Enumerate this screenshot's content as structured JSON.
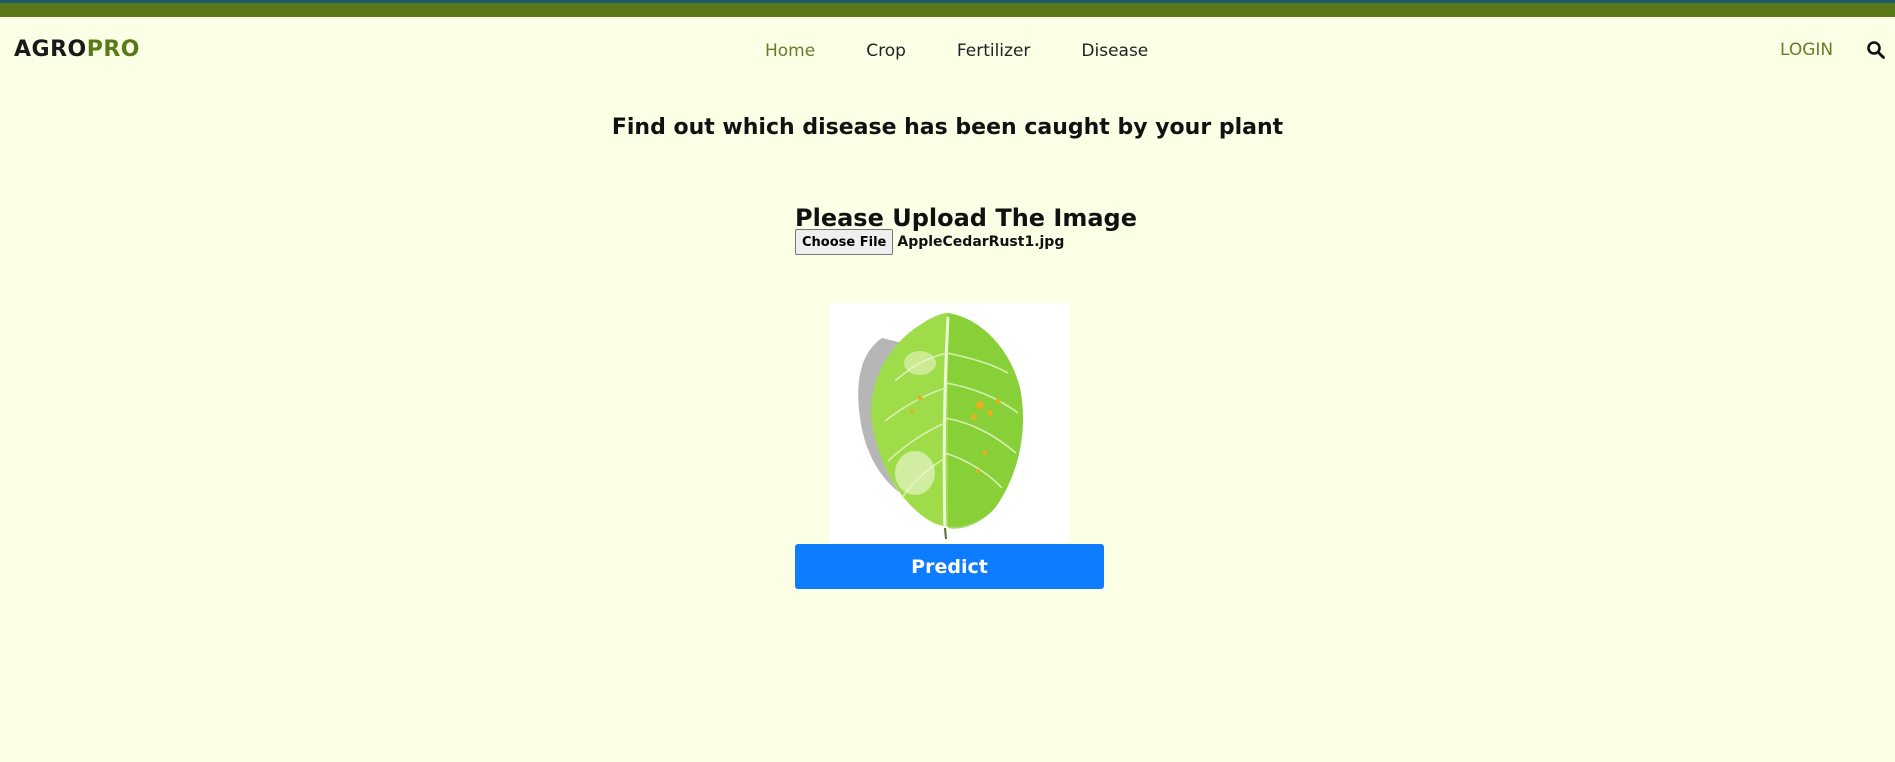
{
  "header": {
    "logo_main": "AGRO",
    "logo_accent": "PRO",
    "nav": [
      {
        "label": "Home"
      },
      {
        "label": "Crop"
      },
      {
        "label": "Fertilizer"
      },
      {
        "label": "Disease"
      }
    ],
    "login_label": "LOGIN",
    "search_icon": "search-icon"
  },
  "main": {
    "headline": "Find out which disease has been caught by your plant",
    "upload_title": "Please Upload The Image",
    "choose_file_label": "Choose File",
    "file_name": "AppleCedarRust1.jpg",
    "preview_icon": "leaf-image",
    "predict_label": "Predict"
  },
  "colors": {
    "background": "#fbffe6",
    "brand_green": "#5a7a1a",
    "accent_olive": "#6b7a2a",
    "primary_blue": "#0d7cff"
  }
}
